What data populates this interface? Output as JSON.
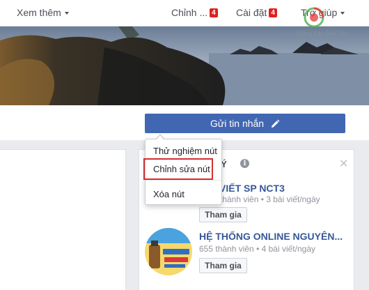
{
  "topbar": {
    "see_more": "Xem thêm",
    "edit": "Chỉnh ...",
    "edit_badge": "4",
    "settings": "Cài đặt",
    "settings_badge": "4",
    "help": "Trợ giúp"
  },
  "watermark": {
    "text": "Quảng Cáo Siêu Tốc"
  },
  "send_message_button": {
    "label": "Gửi tin nhắn",
    "icon": "pencil-icon"
  },
  "menu": {
    "items": [
      "Thử nghiệm nút",
      "Chỉnh sửa nút",
      "Xóa nút"
    ],
    "highlighted": "Chỉnh sửa nút"
  },
  "suggested_groups": {
    "title_partial": "I Ý",
    "groups": [
      {
        "name": "VIẾT SP NCT3",
        "meta": "thành viên • 3 bài viết/ngày",
        "join_label": "Tham gia"
      },
      {
        "name": "HỆ THỐNG ONLINE NGUYÊN...",
        "meta": "655 thành viên • 4 bài viết/ngày",
        "join_label": "Tham gia"
      }
    ]
  },
  "colors": {
    "primary": "#4267b2",
    "highlight": "#d32f2f",
    "badge": "#e02020",
    "link": "#365899"
  }
}
